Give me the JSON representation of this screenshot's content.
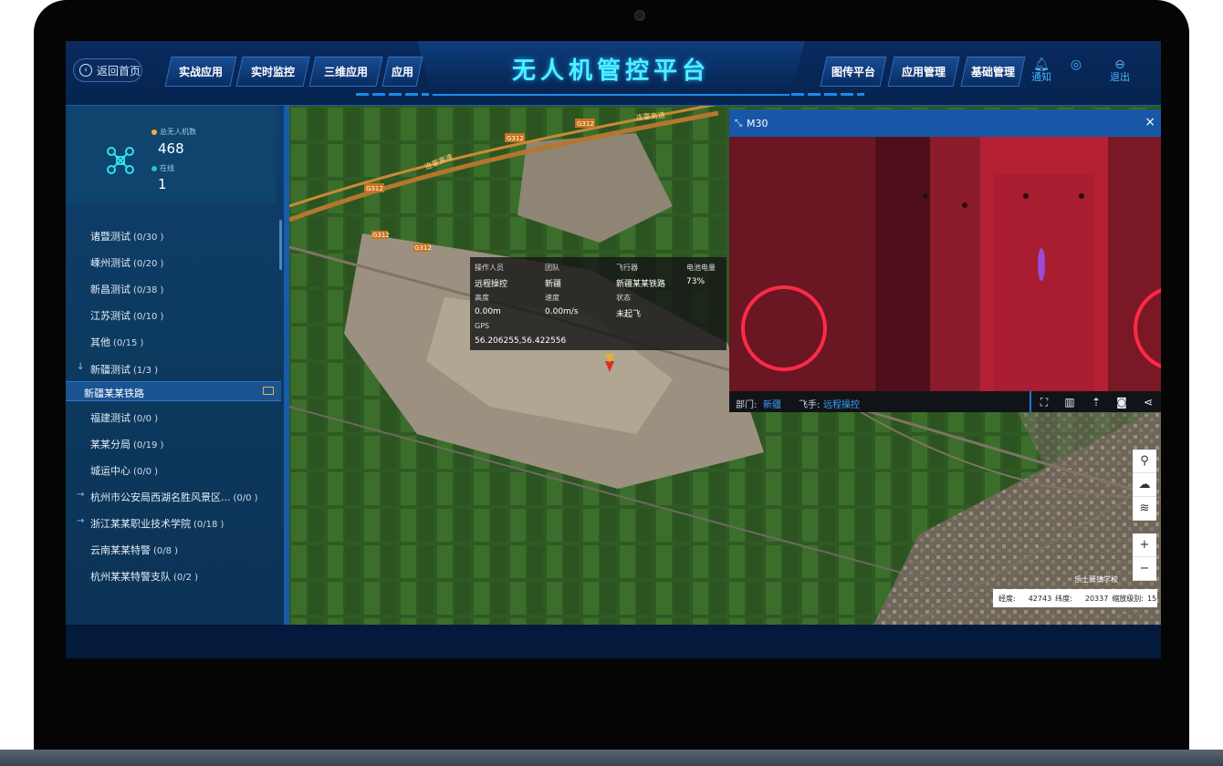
{
  "header": {
    "title": "无人机管控平台",
    "back_label": "返回首页",
    "left_tabs": [
      "实战应用",
      "实时监控",
      "三维应用",
      "应用"
    ],
    "right_tabs": [
      "图传平台",
      "应用管理",
      "基础管理"
    ],
    "notify_label": "通知",
    "logout_label": "退出"
  },
  "stats": {
    "total_label": "总无人机数",
    "total_value": "468",
    "online_label": "在线",
    "online_value": "1",
    "total_dot_color": "#f3b229",
    "online_dot_color": "#27c6b6"
  },
  "tree": {
    "items": [
      {
        "name": "诸暨测试",
        "count": "(0/30 )"
      },
      {
        "name": "嵊州测试",
        "count": "(0/20 )"
      },
      {
        "name": "新昌测试",
        "count": "(0/38 )"
      },
      {
        "name": "江苏测试",
        "count": "(0/10 )"
      },
      {
        "name": "其他",
        "count": "(0/15 )"
      },
      {
        "name": "新疆测试",
        "count": "(1/3 )"
      }
    ],
    "selected": "新疆某某铁路",
    "items_after": [
      {
        "name": "福建测试",
        "count": "(0/0 )"
      },
      {
        "name": "某某分局",
        "count": "(0/19 )"
      },
      {
        "name": "城运中心",
        "count": "(0/0 )"
      },
      {
        "name": "杭州市公安局西湖名胜风景区...",
        "count": "(0/0 )"
      },
      {
        "name": "浙江某某职业技术学院",
        "count": "(0/18 )"
      },
      {
        "name": "云南某某特警",
        "count": "(0/8 )"
      },
      {
        "name": "杭州某某特警支队",
        "count": "(0/2 )"
      }
    ]
  },
  "map": {
    "road_labels": [
      "G312",
      "G312",
      "G312",
      "G312",
      "G312"
    ],
    "highway_label": "连霍高速",
    "school_label": "乐土驿镇学校"
  },
  "info_popup": {
    "operator_label": "操作人员",
    "operator_value": "远程操控",
    "team_label": "团队",
    "team_value": "新疆",
    "aircraft_label": "飞行器",
    "aircraft_value": "新疆某某铁路",
    "battery_label": "电池电量",
    "battery_value": "73%",
    "height_label": "高度",
    "height_value": "0.00m",
    "speed_label": "速度",
    "speed_value": "0.00m/s",
    "status_label": "状态",
    "status_value": "未起飞",
    "gps_label": "GPS",
    "gps_value": "56.206255,56.422556"
  },
  "video": {
    "title": "M30",
    "close_icon": "close-icon",
    "dept_label": "部门:",
    "dept_value": "新疆",
    "pilot_label": "飞手:",
    "pilot_value": "远程操控"
  },
  "coords": {
    "lon_label": "经度:",
    "lon_value": "42743",
    "lat_label": "纬度:",
    "lat_value": "20337",
    "zoom_label": "缩放级别:",
    "zoom_value": "15"
  }
}
